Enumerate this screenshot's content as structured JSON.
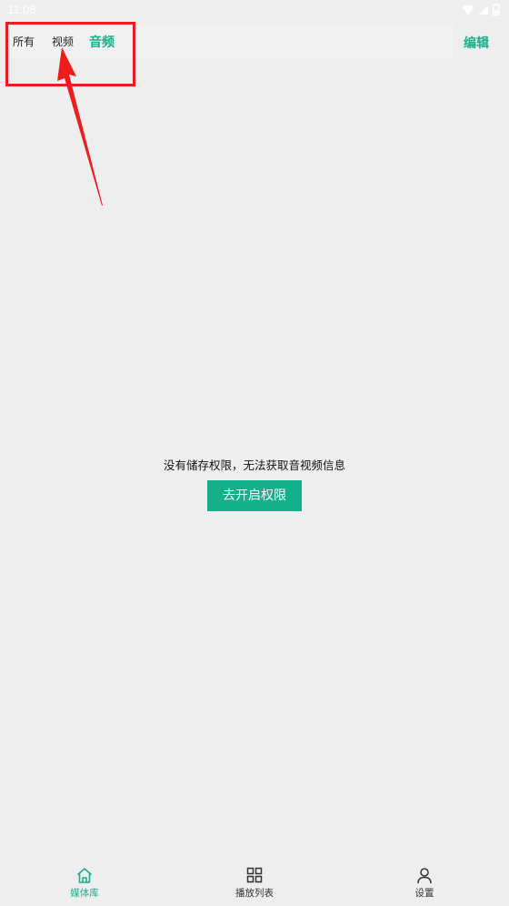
{
  "status_bar": {
    "time": "11:08",
    "icons": [
      "wifi-icon",
      "signal-icon",
      "battery-icon"
    ]
  },
  "tabs": [
    {
      "label": "所有",
      "active": false
    },
    {
      "label": "视频",
      "active": false
    },
    {
      "label": "音频",
      "active": true
    }
  ],
  "edit_label": "编辑",
  "empty_state": {
    "message": "没有储存权限，无法获取音视频信息",
    "button_label": "去开启权限"
  },
  "bottom_nav": [
    {
      "label": "媒体库",
      "icon": "home-icon",
      "active": true
    },
    {
      "label": "播放列表",
      "icon": "grid-icon",
      "active": false
    },
    {
      "label": "设置",
      "icon": "person-icon",
      "active": false
    }
  ],
  "colors": {
    "accent": "#1aaf8b",
    "button": "#14b08a",
    "annotation": "#ee1c1c",
    "background": "#eeeeee"
  }
}
